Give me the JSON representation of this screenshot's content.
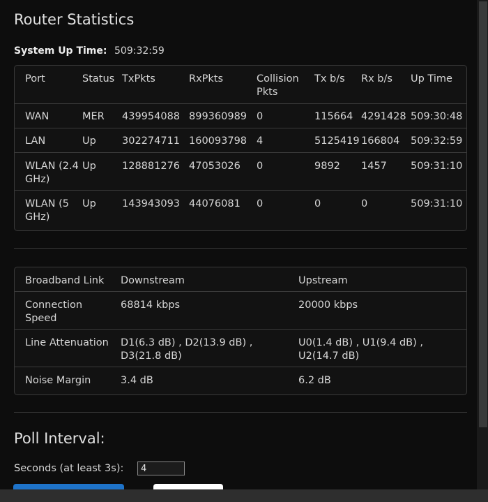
{
  "title": "Router Statistics",
  "uptime": {
    "label": "System Up Time:",
    "value": "509:32:59"
  },
  "port_table": {
    "headers": [
      "Port",
      "Status",
      "TxPkts",
      "RxPkts",
      "Collision Pkts",
      "Tx b/s",
      "Rx b/s",
      "Up Time"
    ],
    "rows": [
      [
        "WAN",
        "MER",
        "439954088",
        "899360989",
        "0",
        "115664",
        "4291428",
        "509:30:48"
      ],
      [
        "LAN",
        "Up",
        "302274711",
        "160093798",
        "4",
        "5125419",
        "166804",
        "509:32:59"
      ],
      [
        "WLAN (2.4 GHz)",
        "Up",
        "128881276",
        "47053026",
        "0",
        "9892",
        "1457",
        "509:31:10"
      ],
      [
        "WLAN (5 GHz)",
        "Up",
        "143943093",
        "44076081",
        "0",
        "0",
        "0",
        "509:31:10"
      ]
    ]
  },
  "broadband_table": {
    "headers": [
      "Broadband Link",
      "Downstream",
      "Upstream"
    ],
    "rows": [
      [
        "Connection Speed",
        "68814 kbps",
        "20000 kbps"
      ],
      [
        "Line Attenuation",
        "D1(6.3 dB) , D2(13.9 dB) , D3(21.8 dB)",
        "U0(1.4 dB) , U1(9.4 dB) , U2(14.7 dB)"
      ],
      [
        "Noise Margin",
        "3.4 dB",
        "6.2 dB"
      ]
    ]
  },
  "poll": {
    "title": "Poll Interval:",
    "seconds_label": "Seconds (at least 3s):",
    "seconds_value": "4"
  }
}
